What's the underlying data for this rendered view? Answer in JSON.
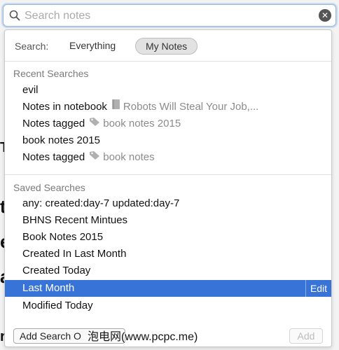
{
  "search": {
    "placeholder": "Search notes"
  },
  "scope": {
    "label": "Search:",
    "options": [
      "Everything",
      "My Notes"
    ],
    "selected": "My Notes"
  },
  "recent": {
    "title": "Recent Searches",
    "items": [
      {
        "text": "evil"
      },
      {
        "text": "Notes in notebook",
        "icon": "notebook-icon",
        "meta": "Robots Will Steal Your Job,..."
      },
      {
        "text": "Notes tagged",
        "icon": "tag-icon",
        "meta": "book notes 2015"
      },
      {
        "text": "book notes 2015"
      },
      {
        "text": "Notes tagged",
        "icon": "tag-icon",
        "meta": "book notes"
      }
    ]
  },
  "saved": {
    "title": "Saved Searches",
    "items": [
      "any: created:day-7 updated:day-7",
      "BHNS Recent Mintues",
      "Book Notes 2015",
      "Created In Last Month",
      "Created Today",
      "Last Month",
      "Modified Today"
    ],
    "selected": "Last Month",
    "edit_label": "Edit"
  },
  "footer": {
    "add_search_label": "Add Search O",
    "add_label": "Add"
  },
  "watermark": "泡电网(www.pcpc.me)",
  "colors": {
    "selection": "#3874d8",
    "meta_text": "#8b8b8b",
    "focus_ring": "#c8daf2"
  }
}
